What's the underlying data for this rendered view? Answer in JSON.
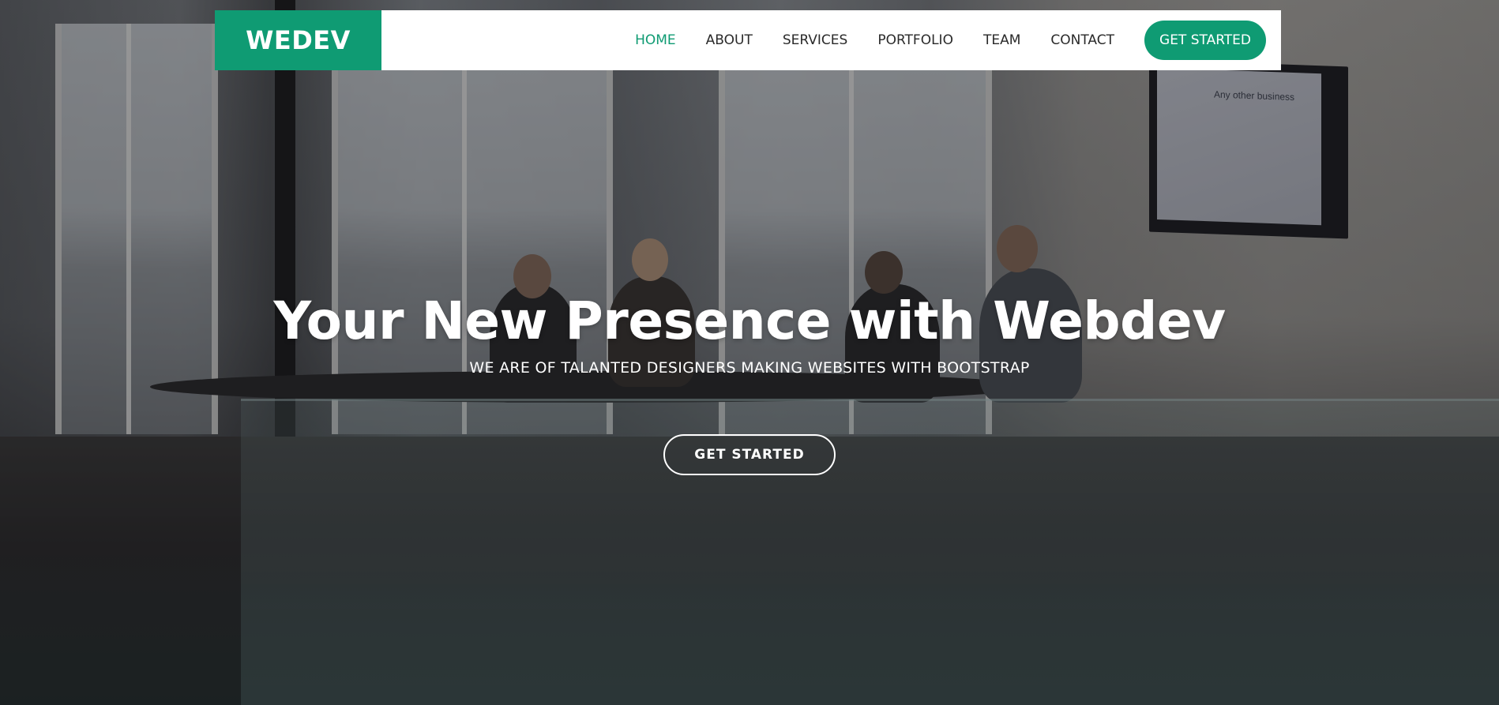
{
  "header": {
    "logo": "WEDEV",
    "nav": [
      {
        "label": "HOME",
        "active": true
      },
      {
        "label": "ABOUT",
        "active": false
      },
      {
        "label": "SERVICES",
        "active": false
      },
      {
        "label": "PORTFOLIO",
        "active": false
      },
      {
        "label": "TEAM",
        "active": false
      },
      {
        "label": "CONTACT",
        "active": false
      }
    ],
    "cta_label": "GET STARTED"
  },
  "hero": {
    "title": "Your New Presence with Webdev",
    "subtitle": "WE ARE OF TALANTED DESIGNERS MAKING WEBSITES WITH BOOTSTRAP",
    "button_label": "GET STARTED",
    "tv_text": "Any other business"
  },
  "colors": {
    "accent": "#0f9b73",
    "header_bg": "#ffffff",
    "nav_text": "#2a2a2a",
    "hero_text": "#ffffff"
  }
}
